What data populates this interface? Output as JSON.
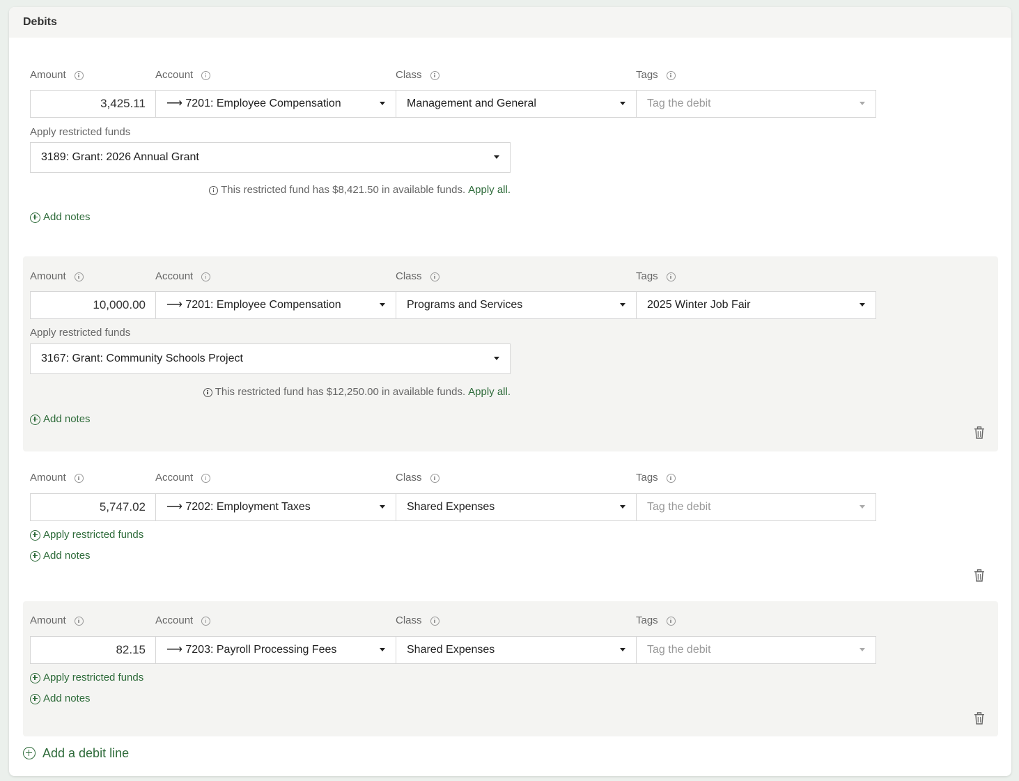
{
  "section_title": "Debits",
  "labels": {
    "amount": "Amount",
    "account": "Account",
    "class": "Class",
    "tags": "Tags",
    "apply_restricted": "Apply restricted funds",
    "add_notes": "Add notes",
    "apply_all": "Apply all."
  },
  "lines": [
    {
      "amount": "3,425.11",
      "account": "⟶ 7201: Employee Compensation",
      "class": "Management and General",
      "tags": "Tag the debit",
      "restricted_fund": "3189: Grant: 2026 Annual Grant",
      "fund_note": "This restricted fund has $8,421.50 in available funds."
    },
    {
      "amount": "10,000.00",
      "account": "⟶ 7201: Employee Compensation",
      "class": "Programs and Services",
      "tags": "2025 Winter Job Fair",
      "restricted_fund": "3167: Grant: Community Schools Project",
      "fund_note": "This restricted fund has $12,250.00 in available funds."
    },
    {
      "amount": "5,747.02",
      "account": "⟶ 7202: Employment Taxes",
      "class": "Shared Expenses",
      "tags": "Tag the debit"
    },
    {
      "amount": "82.15",
      "account": "⟶ 7203: Payroll Processing Fees",
      "class": "Shared Expenses",
      "tags": "Tag the debit"
    }
  ],
  "add_debit_line": "Add a debit line",
  "icons": {
    "info": "info-circle-icon",
    "caret": "caret-down-icon",
    "add": "plus-circle-icon",
    "delete": "trash-icon"
  },
  "colors": {
    "link_green": "#2e6b3a",
    "shaded_row": "#f4f4f2",
    "page_background": "#ebf0ec"
  }
}
